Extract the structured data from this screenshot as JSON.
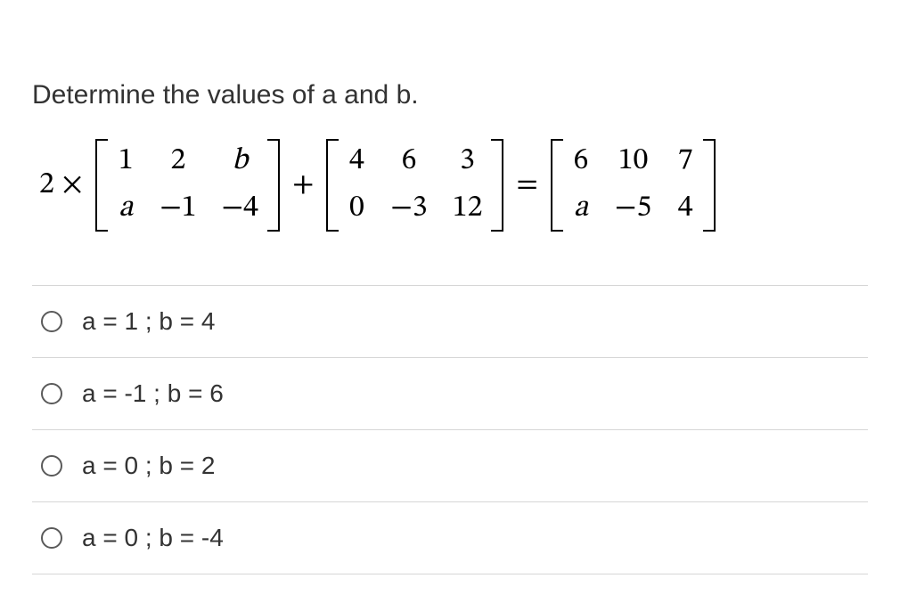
{
  "question": "Determine the values of a and b.",
  "equation": {
    "scalar": "2 ×",
    "op_plus": "+",
    "op_eq": "=",
    "m1": {
      "r1": [
        "1",
        "2",
        "b"
      ],
      "r2": [
        "a",
        "−1",
        "−4"
      ]
    },
    "m2": {
      "r1": [
        "4",
        "6",
        "3"
      ],
      "r2": [
        "0",
        "−3",
        "12"
      ]
    },
    "m3": {
      "r1": [
        "6",
        "10",
        "7"
      ],
      "r2": [
        "a",
        "−5",
        "4"
      ]
    }
  },
  "options": [
    "a = 1 ; b = 4",
    "a = -1 ; b = 6",
    "a = 0 ; b = 2",
    "a = 0 ; b = -4"
  ]
}
